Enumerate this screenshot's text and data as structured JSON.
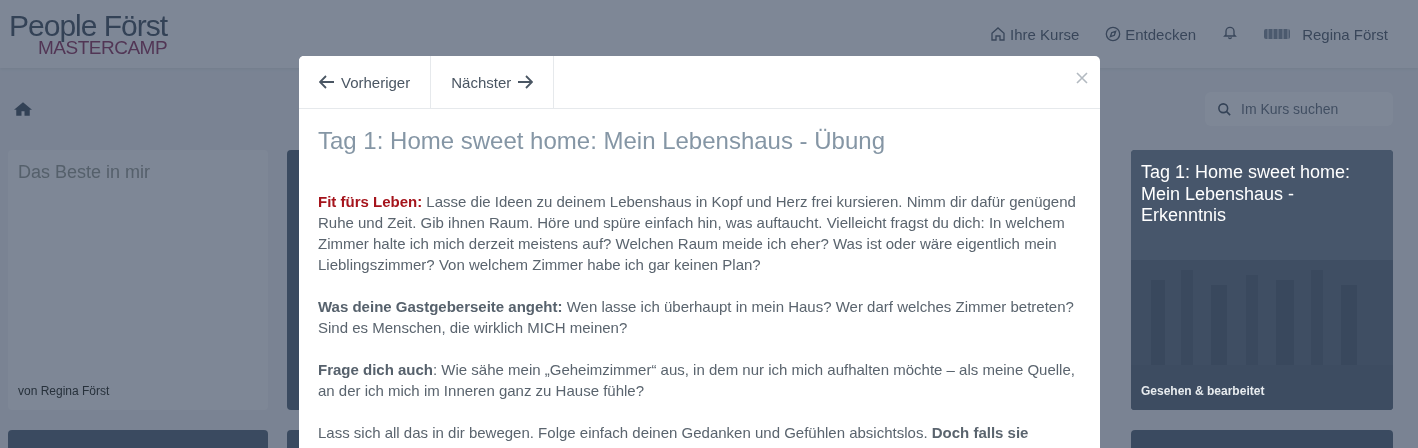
{
  "brand": {
    "name": "People Först",
    "tagline": "MASTERCAMP"
  },
  "nav": [
    {
      "kind": "home",
      "label": "Ihre Kurse"
    },
    {
      "kind": "compass",
      "label": "Entdecken"
    },
    {
      "kind": "bell"
    },
    {
      "kind": "user",
      "label": "Regina Först"
    }
  ],
  "search": {
    "placeholder": "Im Kurs suchen"
  },
  "cards": [
    {
      "kind": "plain",
      "title": "Das Beste in mir",
      "footer": "von Regina Först"
    },
    {
      "kind": "hidden"
    },
    {
      "title": "Tag 1: Home sweet home: Mein Lebenshaus - Erkenntnis",
      "footer": "Gesehen & bearbeitet"
    }
  ],
  "modal": {
    "prev": "Vorheriger",
    "next": "Nächster",
    "title": "Tag 1: Home sweet home: Mein Lebenshaus - Übung",
    "paragraphs": [
      {
        "lead": "Fit fürs Leben:",
        "kind": "accent",
        "text": " Lasse die Ideen zu deinem Lebenshaus in Kopf und Herz frei kursieren. Nimm dir dafür genügend Ruhe und Zeit. Gib ihnen Raum. Höre und spüre einfach hin, was auftaucht. Vielleicht fragst du dich: In welchem Zimmer halte ich mich derzeit meistens auf? Welchen Raum meide ich eher? Was ist oder wäre eigentlich mein Lieblingszimmer? Von welchem Zimmer habe ich gar keinen Plan?"
      },
      {
        "lead": "Was deine Gastgeberseite angeht:",
        "kind": "bold",
        "text": " Wen lasse ich überhaupt in mein Haus? Wer darf welches Zimmer betreten? Sind es Menschen, die wirklich MICH meinen?"
      },
      {
        "lead": "Frage dich auch",
        "kind": "bold",
        "text": ": Wie sähe mein „Geheimzimmer“ aus, in dem nur ich mich aufhalten möchte – als meine Quelle, an der ich mich im Inneren ganz zu Hause fühle?"
      },
      {
        "kind": "plain",
        "text": "Lass sich all das in dir bewegen. Folge einfach deinen Gedanken und Gefühlen absichtslos. **Doch falls sie**"
      }
    ]
  }
}
